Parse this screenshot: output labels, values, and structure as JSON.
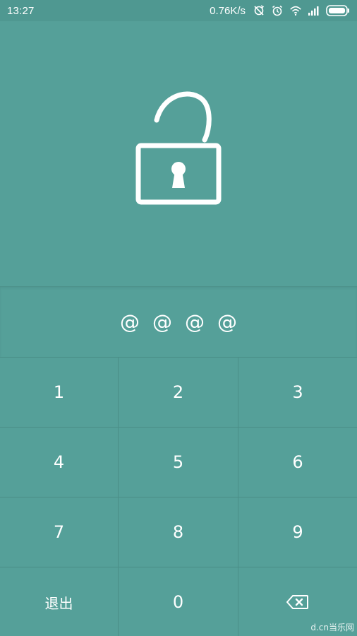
{
  "status_bar": {
    "time": "13:27",
    "net_speed": "0.76K/s",
    "icons": [
      "sync-off-icon",
      "alarm-icon",
      "wifi-icon",
      "signal-icon",
      "battery-icon"
    ]
  },
  "lock": {
    "icon": "unlocked-padlock-icon",
    "state": "unlocked"
  },
  "pin": {
    "chars": [
      "@",
      "@",
      "@",
      "@"
    ]
  },
  "keypad": {
    "keys": [
      "1",
      "2",
      "3",
      "4",
      "5",
      "6",
      "7",
      "8",
      "9",
      "退出",
      "0"
    ],
    "exit_label": "退出",
    "backspace_icon": "backspace-icon"
  },
  "watermark": "d.cn当乐网",
  "colors": {
    "background": "#55a099",
    "status_bar": "#4f9891",
    "divider": "#4a8e87",
    "foreground": "#ffffff"
  }
}
